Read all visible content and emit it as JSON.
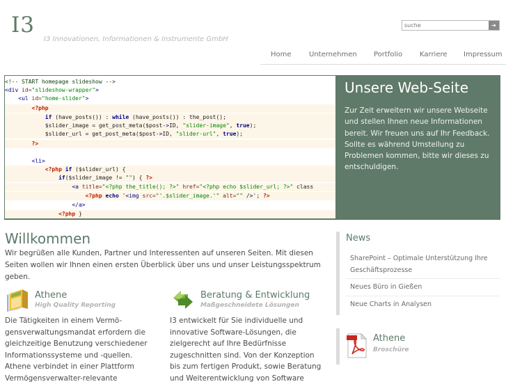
{
  "header": {
    "logo": "I3",
    "tagline": "I3 Innovationen, Informationen & Instrumente GmbH",
    "search_placeholder": "suche",
    "search_button_icon": "arrow-right-icon"
  },
  "nav": [
    "Home",
    "Unternehmen",
    "Portfolio",
    "Karriere",
    "Impressum"
  ],
  "slideshow": {
    "title": "Unsere Web-Seite",
    "text": "Zur Zeit erweitern wir unsere Webseite und stellen Ihnen neue Informationen bereit. Wir freuen uns auf Ihr Feedback. Sollte es während Umstellung zu Problemen kommen, bitte wir dieses zu entschuldigen.",
    "code_lines": [
      "<!-- START homepage slideshow -->",
      "<div id=\"slideshow-wrapper\">",
      "    <ul id=\"home-slider\">",
      "        <?php",
      "            if (have_posts()) : while (have_posts()) : the_post();",
      "            $slider_image = get_post_meta($post->ID, \"slider-image\", true);",
      "            $slider_url = get_post_meta($post->ID, \"slider-url\", true);",
      "        ?>",
      "",
      "        <li>",
      "            <?php if ($slider_url) {",
      "                if($slider_image != \"\") { ?>",
      "                    <a title=\"<?php the_title(); ?>\" href=\"<?php echo $slider_url; ?>\" class",
      "                        <?php echo '<img src=\"'.$slider_image.'\" alt=\"\" />'; ?>",
      "                    </a>",
      "                <?php }"
    ]
  },
  "welcome": {
    "title": "Willkommen",
    "text": "Wir begrüßen alle Kunden, Partner und Interessenten auf unseren Seiten. Mit diesen Seiten wollen wir Ihnen einen ersten Überblick über uns und unser Leistungsspektrum geben."
  },
  "features": [
    {
      "icon": "book-icon",
      "title": "Athene",
      "subtitle": "High Quality Reporting",
      "text": "Die Tätigkeiten in einem Vermö-gensverwaltungsmandat erfordern die gleichzeitige Benutzung verschiedener Informationssysteme und -quellen. Athene verbindet in einer Plattform Vermögensverwalter-relevante"
    },
    {
      "icon": "green-arrows-icon",
      "title": "Beratung & Entwicklung",
      "subtitle": "Maßgeschneidete Lösungen",
      "text": "I3 entwickelt für Sie individuelle und innovative Software-Lösungen, die zielgerecht auf Ihre Bedürfnisse zugeschnitten sind. Von der Konzeption bis zum fertigen Produkt, sowie Beratung und Weiterentwicklung von Software"
    }
  ],
  "news": {
    "title": "News",
    "items": [
      "SharePoint – Optimale Unterstützung Ihre Geschäftsprozesse",
      "Neues Büro in Gießen",
      "Neue Charts in Analysen"
    ]
  },
  "brochure": {
    "icon": "pdf-icon",
    "title": "Athene",
    "subtitle": "Broschüre"
  },
  "colors": {
    "accent_green": "#5b7a68",
    "slide_bg": "#5f7a68"
  }
}
